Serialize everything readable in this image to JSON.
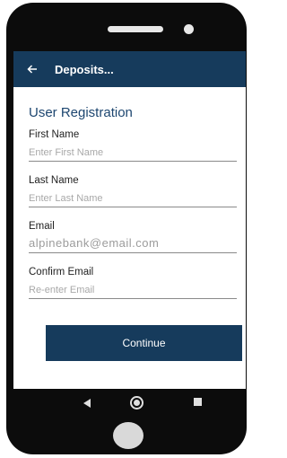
{
  "appbar": {
    "title": "Deposits...",
    "back_icon": "arrow-left-icon"
  },
  "form": {
    "title": "User Registration",
    "first_name": {
      "label": "First Name",
      "placeholder": "Enter First Name"
    },
    "last_name": {
      "label": "Last Name",
      "placeholder": "Enter Last Name"
    },
    "email": {
      "label": "Email",
      "value": "alpinebank@email.com"
    },
    "confirm_email": {
      "label": "Confirm Email",
      "placeholder": "Re-enter Email"
    },
    "continue_label": "Continue"
  },
  "navbar": {
    "icons": [
      "nav-back-icon",
      "nav-home-icon",
      "nav-recents-icon"
    ]
  },
  "colors": {
    "primary": "#163b5c",
    "title_text": "#1d4670"
  }
}
